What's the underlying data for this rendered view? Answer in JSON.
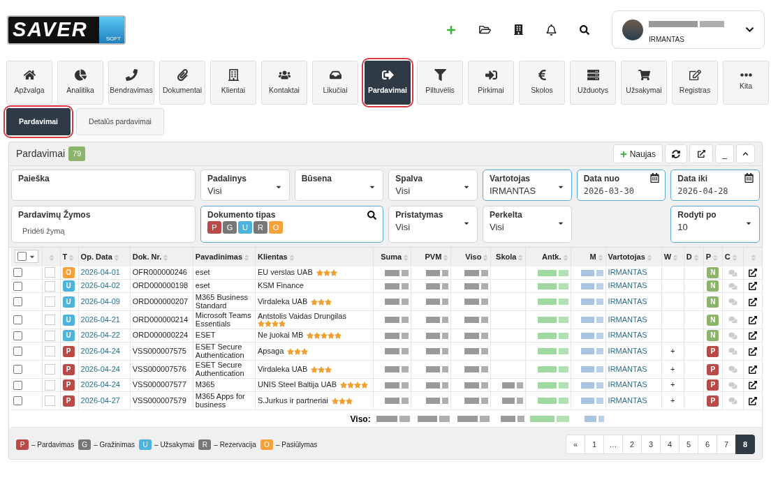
{
  "logo": {
    "text": "SAVER",
    "sub": "SOFT"
  },
  "user": {
    "role": "IRMANTAS"
  },
  "nav": [
    {
      "label": "Apžvalga",
      "selected": false
    },
    {
      "label": "Analitika",
      "selected": false
    },
    {
      "label": "Bendravimas",
      "selected": false
    },
    {
      "label": "Dokumentai",
      "selected": false
    },
    {
      "label": "Klientai",
      "selected": false
    },
    {
      "label": "Kontaktai",
      "selected": false
    },
    {
      "label": "Likučiai",
      "selected": false
    },
    {
      "label": "Pardavimai",
      "selected": true
    },
    {
      "label": "Piltuvėlis",
      "selected": false
    },
    {
      "label": "Pirkimai",
      "selected": false
    },
    {
      "label": "Skolos",
      "selected": false
    },
    {
      "label": "Užduotys",
      "selected": false
    },
    {
      "label": "Užsakymai",
      "selected": false
    },
    {
      "label": "Registras",
      "selected": false
    },
    {
      "label": "Kita",
      "selected": false
    }
  ],
  "subtabs": [
    {
      "label": "Pardavimai",
      "selected": true
    },
    {
      "label": "Detalūs pardavimai",
      "selected": false
    }
  ],
  "panel": {
    "title": "Pardavimai",
    "count": "79",
    "new_button": "Naujas",
    "minimize": "_"
  },
  "filters_row1": [
    {
      "kind": "text",
      "label": "Paieška",
      "highlighted": false
    },
    {
      "kind": "select",
      "label": "Padalinys",
      "value": "Visi",
      "highlighted": false
    },
    {
      "kind": "select",
      "label": "Būsena",
      "highlighted": false
    },
    {
      "kind": "select",
      "label": "Spalva",
      "value": "Visi",
      "highlighted": false
    },
    {
      "kind": "select",
      "label": "Vartotojas",
      "value": "IRMANTAS",
      "highlighted": true
    },
    {
      "kind": "date",
      "label": "Data nuo",
      "value": "2026-03-30",
      "highlighted": true
    },
    {
      "kind": "date",
      "label": "Data iki",
      "value": "2026-04-28",
      "highlighted": true
    }
  ],
  "filters_row2": [
    {
      "kind": "tags",
      "label": "Pardavimų Žymos",
      "placeholder": "Pridėti žymą",
      "highlighted": false
    },
    {
      "kind": "doctypes",
      "label": "Dokumento tipas",
      "highlighted": true,
      "badges": [
        {
          "letter": "P",
          "color": "#b94a48"
        },
        {
          "letter": "G",
          "color": "#777777"
        },
        {
          "letter": "U",
          "color": "#4bb3dd"
        },
        {
          "letter": "R",
          "color": "#777777"
        },
        {
          "letter": "O",
          "color": "#f6a13a"
        }
      ]
    },
    {
      "kind": "select",
      "label": "Pristatymas",
      "value": "Visi",
      "highlighted": false
    },
    {
      "kind": "select",
      "label": "Perkelta",
      "value": "Visi",
      "highlighted": false
    },
    {
      "kind": "select",
      "label": "Rodyti po",
      "value": "10",
      "highlighted": true
    }
  ],
  "table": {
    "select_all": {
      "checked": false
    },
    "columns": [
      "T",
      "Op. Data",
      "Dok. Nr.",
      "Pavadinimas",
      "Klientas",
      "Suma",
      "PVM",
      "Viso",
      "Skola",
      "Antk.",
      "M",
      "Vartotojas",
      "W",
      "D",
      "P",
      "C"
    ],
    "rows": [
      {
        "checked": false,
        "marked": false,
        "type": {
          "letter": "O",
          "color": "#f6a13a"
        },
        "date": "2026-04-01",
        "doc": "OFR000000246",
        "name": "eset",
        "client": "EU verslas UAB",
        "stars": 3,
        "debt_blurred": false,
        "user": "IRMANTAS",
        "p": {
          "letter": "N",
          "color": "#8cb56b"
        }
      },
      {
        "checked": false,
        "marked": false,
        "type": {
          "letter": "U",
          "color": "#4bb3dd"
        },
        "date": "2026-04-02",
        "doc": "ORD000000198",
        "name": "eset",
        "client": "KSM Finance",
        "debt_blurred": false,
        "user": "IRMANTAS",
        "p": {
          "letter": "N",
          "color": "#8cb56b"
        }
      },
      {
        "checked": false,
        "marked": false,
        "type": {
          "letter": "U",
          "color": "#4bb3dd"
        },
        "date": "2026-04-09",
        "doc": "ORD000000207",
        "name": "M365 Business Standard",
        "client": "Virdaleka UAB",
        "stars": 3,
        "debt_blurred": false,
        "user": "IRMANTAS",
        "p": {
          "letter": "N",
          "color": "#8cb56b"
        }
      },
      {
        "checked": false,
        "marked": false,
        "type": {
          "letter": "U",
          "color": "#4bb3dd"
        },
        "date": "2026-04-21",
        "doc": "ORD000000214",
        "name": "Microsoft Teams Essentials",
        "client": "Antstolis Vaidas Drungilas",
        "stars": 4,
        "debt_blurred": false,
        "user": "IRMANTAS",
        "p": {
          "letter": "N",
          "color": "#8cb56b"
        }
      },
      {
        "checked": false,
        "marked": false,
        "type": {
          "letter": "U",
          "color": "#4bb3dd"
        },
        "date": "2026-04-22",
        "doc": "ORD000000224",
        "name": "ESET",
        "client": "Ne juokai MB",
        "stars": 5,
        "debt_blurred": false,
        "user": "IRMANTAS",
        "p": {
          "letter": "N",
          "color": "#8cb56b"
        }
      },
      {
        "checked": false,
        "marked": false,
        "type": {
          "letter": "P",
          "color": "#b94a48"
        },
        "date": "2026-04-24",
        "doc": "VSS000007575",
        "name": "ESET Secure Authentication",
        "client": "Apsaga",
        "stars": 3,
        "debt_blurred": false,
        "user": "IRMANTAS",
        "w": "+",
        "p": {
          "letter": "P",
          "color": "#b94a48"
        }
      },
      {
        "checked": false,
        "marked": false,
        "type": {
          "letter": "P",
          "color": "#b94a48"
        },
        "date": "2026-04-24",
        "doc": "VSS000007576",
        "name": "ESET Secure Authentication",
        "client": "Virdaleka UAB",
        "stars": 3,
        "debt_blurred": false,
        "user": "IRMANTAS",
        "w": "+",
        "p": {
          "letter": "P",
          "color": "#b94a48"
        }
      },
      {
        "checked": false,
        "marked": false,
        "type": {
          "letter": "P",
          "color": "#b94a48"
        },
        "date": "2026-04-24",
        "doc": "VSS000007577",
        "name": "M365",
        "client": "UNIS Steel Baltija UAB",
        "stars": 4,
        "debt_blurred": true,
        "user": "IRMANTAS",
        "w": "+",
        "p": {
          "letter": "P",
          "color": "#b94a48"
        }
      },
      {
        "checked": false,
        "marked": false,
        "type": {
          "letter": "P",
          "color": "#b94a48"
        },
        "date": "2026-04-27",
        "doc": "VSS000007579",
        "name": "M365 Apps for business",
        "client": "S.Jurkus ir partneriai",
        "stars": 3,
        "debt_blurred": true,
        "user": "IRMANTAS",
        "w": "+",
        "p": {
          "letter": "P",
          "color": "#b94a48"
        }
      }
    ],
    "total_label": "Viso:"
  },
  "legend": [
    {
      "letter": "P",
      "label": "– Pardavimas",
      "color": "#b94a48"
    },
    {
      "letter": "G",
      "label": "– Gražinimas",
      "color": "#777777"
    },
    {
      "letter": "U",
      "label": "– Užsakymai",
      "color": "#4bb3dd"
    },
    {
      "letter": "R",
      "label": "– Rezervacija",
      "color": "#777777"
    },
    {
      "letter": "O",
      "label": "– Pasiūlymas",
      "color": "#f6a13a"
    }
  ],
  "pagination": [
    {
      "label": "«",
      "selected": false
    },
    {
      "label": "1",
      "selected": false
    },
    {
      "label": "…",
      "selected": false
    },
    {
      "label": "2",
      "selected": false
    },
    {
      "label": "3",
      "selected": false
    },
    {
      "label": "4",
      "selected": false
    },
    {
      "label": "5",
      "selected": false
    },
    {
      "label": "6",
      "selected": false
    },
    {
      "label": "7",
      "selected": false
    },
    {
      "label": "8",
      "selected": true
    }
  ]
}
